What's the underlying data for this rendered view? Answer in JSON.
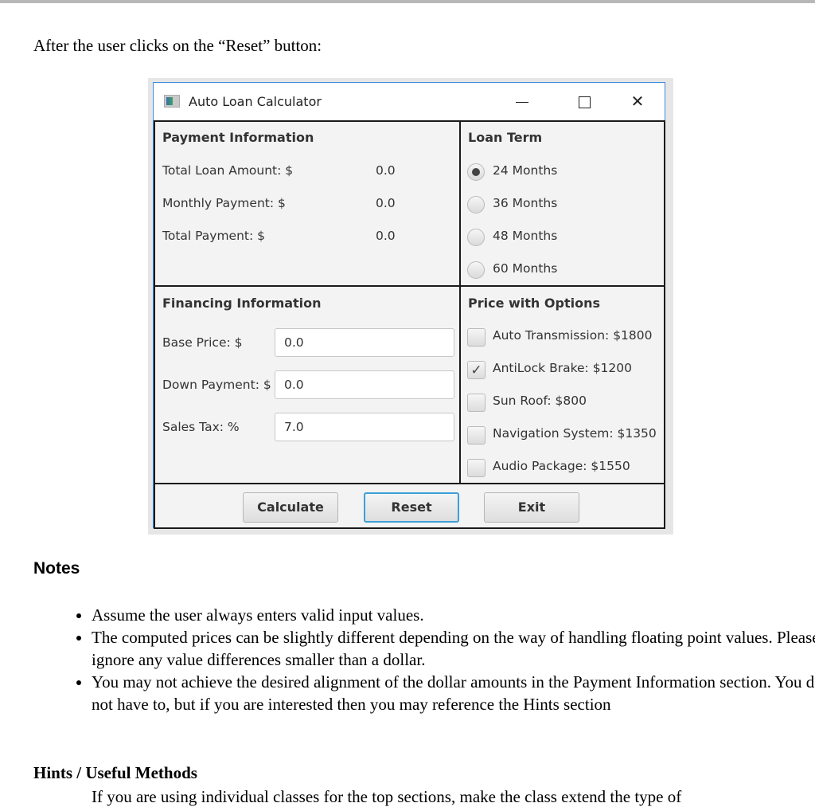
{
  "document": {
    "intro": "After the user clicks on the “Reset” button:",
    "notes_heading": "Notes",
    "notes": [
      "Assume the user always enters valid input values.",
      "The computed prices can be slightly different depending on the way of handling floating point values.  Please ignore any value differences smaller than a dollar.",
      "You may not achieve the desired alignment of the dollar amounts in the Payment Information section. You do not have to, but if you are interested then you may reference the Hints section"
    ],
    "hints_heading": "Hints / Useful Methods",
    "hints_partial": "If you are using individual classes for the top sections, make the class extend the type of"
  },
  "window": {
    "title": "Auto Loan Calculator",
    "icon": "app-icon",
    "controls": {
      "minimize": "minimize-icon",
      "maximize": "maximize-icon",
      "close": "✕"
    },
    "accent_color": "#3c8be0"
  },
  "payment_info": {
    "title": "Payment Information",
    "rows": [
      {
        "label": "Total Loan Amount: $",
        "value": "0.0"
      },
      {
        "label": "Monthly Payment: $",
        "value": "0.0"
      },
      {
        "label": "Total Payment: $",
        "value": "0.0"
      }
    ]
  },
  "loan_term": {
    "title": "Loan Term",
    "options": [
      {
        "label": "24 Months",
        "selected": true
      },
      {
        "label": "36 Months",
        "selected": false
      },
      {
        "label": "48 Months",
        "selected": false
      },
      {
        "label": "60 Months",
        "selected": false
      }
    ]
  },
  "financing_info": {
    "title": "Financing Information",
    "fields": [
      {
        "label": "Base Price: $",
        "value": "0.0"
      },
      {
        "label": "Down Payment: $",
        "value": "0.0"
      },
      {
        "label": "Sales Tax: %",
        "value": "7.0"
      }
    ]
  },
  "price_options": {
    "title": "Price with Options",
    "options": [
      {
        "label": "Auto Transmission: $1800",
        "checked": false,
        "mark": ""
      },
      {
        "label": "AntiLock Brake: $1200",
        "checked": true,
        "mark": "✓"
      },
      {
        "label": "Sun Roof: $800",
        "checked": false,
        "mark": ""
      },
      {
        "label": "Navigation System: $1350",
        "checked": false,
        "mark": ""
      },
      {
        "label": "Audio Package: $1550",
        "checked": false,
        "mark": ""
      }
    ]
  },
  "buttons": {
    "calculate": "Calculate",
    "reset": "Reset",
    "exit": "Exit",
    "focused": "reset"
  }
}
